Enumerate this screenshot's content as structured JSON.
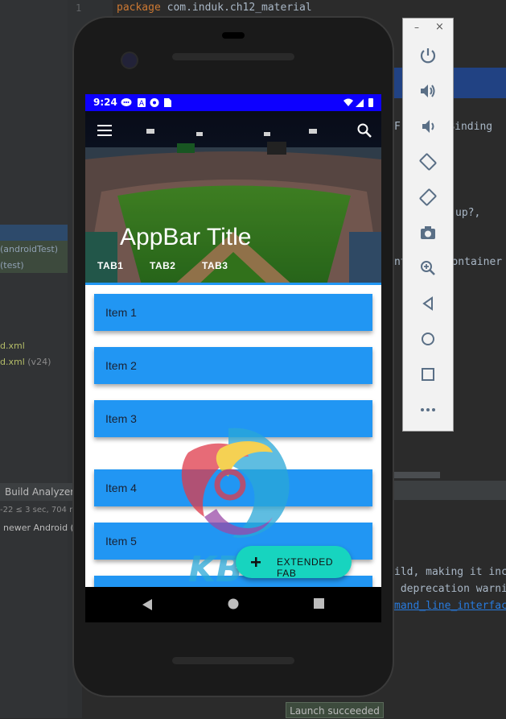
{
  "ide": {
    "line_number": "1",
    "code_line_keyword": "package",
    "code_line_rest": " com.induk.ch12_material",
    "tree_items": [
      "(androidTest)",
      "(test)",
      "d.xml",
      "d.xml",
      "(v24)"
    ],
    "build_analyzer_tab": "Build Analyzer",
    "build_time": "-22 ≤ 3 sec, 704 m",
    "build_msg": "newer Android (",
    "code_frag_1": "Fr",
    "code_frag_2": "woBinding",
    "code_frag_3": "up?,",
    "code_frag_4": "nt",
    "code_frag_5": "container",
    "console_line_1": "ild, making it inc",
    "console_line_2": " deprecation warni",
    "console_link": "mand_line_interfac",
    "launch_status": "Launch succeeded"
  },
  "phone": {
    "status_bar": {
      "time": "9:24"
    },
    "appbar": {
      "title": "AppBar Title",
      "tabs": [
        "TAB1",
        "TAB2",
        "TAB3"
      ]
    },
    "items": [
      "Item 1",
      "Item 2",
      "Item 3",
      "Item 4",
      "Item 5",
      ""
    ],
    "fab": {
      "label": "EXTENDED FAB",
      "icon": "plus-icon"
    },
    "watermark": "KB"
  },
  "emulator_toolbar": {
    "buttons": [
      "power-icon",
      "volume-up-icon",
      "volume-down-icon",
      "rotate-left-icon",
      "rotate-right-icon",
      "camera-icon",
      "zoom-icon",
      "back-icon",
      "home-icon",
      "overview-icon",
      "more-icon"
    ]
  },
  "colors": {
    "status_bar": "#0d00ff",
    "card": "#2196f3",
    "fab": "#17d4bf"
  }
}
